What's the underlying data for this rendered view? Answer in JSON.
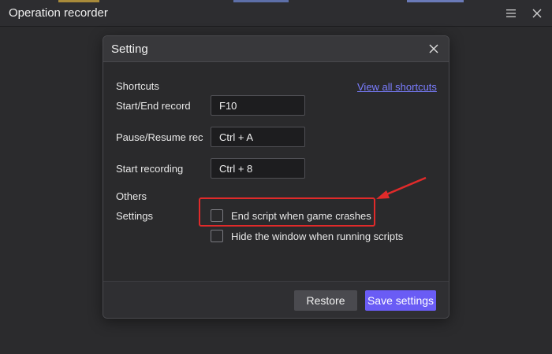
{
  "app": {
    "title": "Operation recorder",
    "menu_icon": "hamburger-icon",
    "close_icon": "close-icon"
  },
  "dialog": {
    "title": "Setting",
    "close_icon": "close-icon",
    "shortcuts": {
      "section_label": "Shortcuts",
      "view_all_link": "View all shortcuts",
      "rows": [
        {
          "label": "Start/End record",
          "value": "F10"
        },
        {
          "label": "Pause/Resume rec",
          "value": "Ctrl + A"
        },
        {
          "label": "Start recording",
          "value": "Ctrl + 8"
        }
      ]
    },
    "others": {
      "section_label": "Others",
      "settings_label": "Settings",
      "options": [
        {
          "label": "End script when game crashes",
          "checked": false
        },
        {
          "label": "Hide the window when running scripts",
          "checked": false
        }
      ]
    },
    "buttons": {
      "restore": "Restore",
      "save": "Save settings"
    }
  },
  "colors": {
    "accent": "#6a5cf5",
    "link": "#7a7dff",
    "annotation": "#e02a2a"
  }
}
